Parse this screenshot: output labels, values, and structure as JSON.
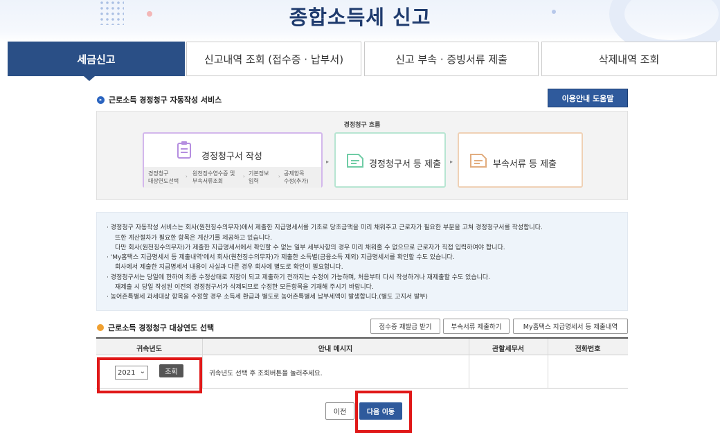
{
  "header": {
    "title": "종합소득세 신고"
  },
  "tabs": [
    {
      "label": "세금신고"
    },
    {
      "label": "신고내역 조회 (접수증 · 납부서)"
    },
    {
      "label": "신고 부속 · 증빙서류 제출"
    },
    {
      "label": "삭제내역 조회"
    }
  ],
  "section1": {
    "title": "근로소득 경정청구 자동작성 서비스",
    "help_button": "이용안내 도움말"
  },
  "flow": {
    "caption": "경정청구 흐름",
    "step1": {
      "title": "경정청구서 작성",
      "substeps": [
        {
          "l1": "경정청구",
          "l2": "대상연도선택"
        },
        {
          "l1": "원천징수영수증 및",
          "l2": "부속서류조회"
        },
        {
          "l1": "기본정보",
          "l2": "입력"
        },
        {
          "l1": "공제항목",
          "l2": "수정(추가)"
        }
      ]
    },
    "step2": {
      "title": "경정청구서 등 제출"
    },
    "step3": {
      "title": "부속서류 등 제출"
    }
  },
  "notes": [
    "· 경정청구 자동작성 서비스는 회사(원천징수의무자)에서 제출한 지급명세서를 기초로 당초금액을 미리 채워주고 근로자가 필요한 부분을 고쳐 경정청구서를 작성합니다.",
    "뜨한 계산절차가 필요한 항목은 계산기를 제공하고 있습니다.",
    "다만 회사(원천징수의무자)가 제출한 지급명세서에서 확인할 수 없는 일부 세부사항의 경우 미리 채워줄 수 없으므로 근로자가 직접 입력하여야 합니다.",
    "· 'My홈택스 지급명세서 등 제출내역'에서 회사(원천징수의무자)가 제출한 소득별(금융소득 제외) 지급명세서를 확인할 수도 있습니다.",
    "회사에서 제출한 지급명세서 내용이 사실과 다른 경우 회사에 별도로 확인이 필요합니다.",
    "· 경정청구서는 당일에 한하여 최종 수정상태로 저장이 되고 제출하기 전까지는 수정이 가능하며, 처음부터 다시 작성하거나 재제출할 수도 있습니다.",
    "재제출 시 당일 작성된 이전의 경정청구서가 삭제되므로 수정한 모든항목을 기재해 주시기 바랍니다.",
    "· 농어촌특별세 과세대상 항목을 수정할 경우 소득세 환급과 별도로 농어촌특별세 납부세액이 발생합니다.(별도 고지서 발부)"
  ],
  "section2": {
    "title": "근로소득 경정청구 대상연도 선택",
    "buttons": [
      "접수증 재발급 받기",
      "부속서류 제출하기",
      "My홈택스 지급명세서 등 제출내역"
    ]
  },
  "table": {
    "headers": [
      "귀속년도",
      "안내 메시지",
      "관할세무서",
      "전화번호"
    ],
    "row": {
      "year": "2021",
      "query_button": "조회",
      "message": "귀속년도 선택 후 조회버튼을 눌러주세요.",
      "office": "",
      "phone": ""
    }
  },
  "footer": {
    "prev": "이전",
    "next": "다음 이동"
  },
  "colors": {
    "primary": "#2a4f86",
    "highlight": "#e01818",
    "accent_orange": "#f0a030"
  }
}
